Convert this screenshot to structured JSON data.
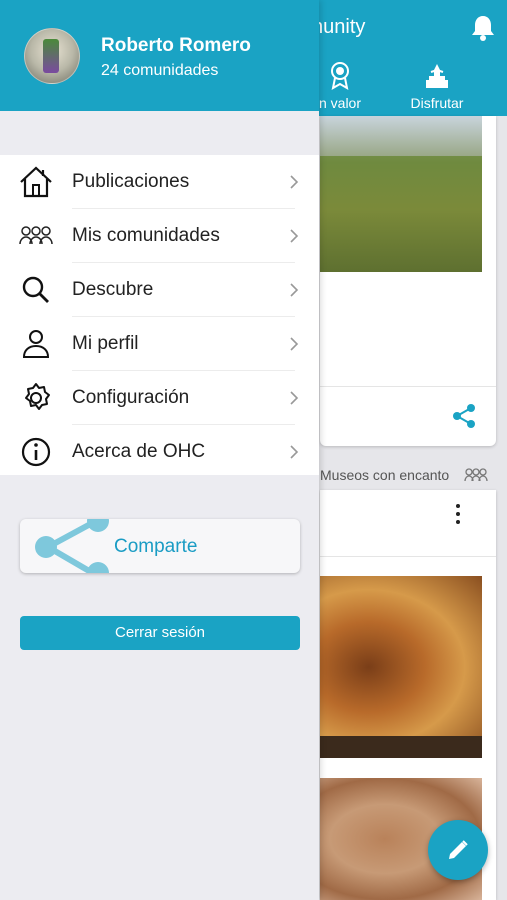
{
  "background": {
    "header_title": "nunity",
    "tabs": [
      {
        "label": "n valor",
        "icon": "award-icon"
      },
      {
        "label": "Disfrutar",
        "icon": "statue-icon"
      }
    ],
    "group_label": "Museos con encanto",
    "icons": [
      "bell-icon",
      "share-icon",
      "more-vertical-icon",
      "edit-icon"
    ]
  },
  "drawer": {
    "user": {
      "name": "Roberto Romero",
      "subtitle": "24 comunidades"
    },
    "menu": [
      {
        "label": "Publicaciones",
        "icon": "home-icon"
      },
      {
        "label": "Mis comunidades",
        "icon": "people-icon"
      },
      {
        "label": "Descubre",
        "icon": "search-icon"
      },
      {
        "label": "Mi perfil",
        "icon": "user-icon"
      },
      {
        "label": "Configuración",
        "icon": "gear-icon"
      },
      {
        "label": "Acerca de OHC",
        "icon": "info-icon"
      }
    ],
    "share_label": "Comparte",
    "logout_label": "Cerrar sesión"
  },
  "colors": {
    "accent": "#1aa3c4",
    "drawer_bg": "#ececf1",
    "share_text": "#1a9cc4"
  }
}
